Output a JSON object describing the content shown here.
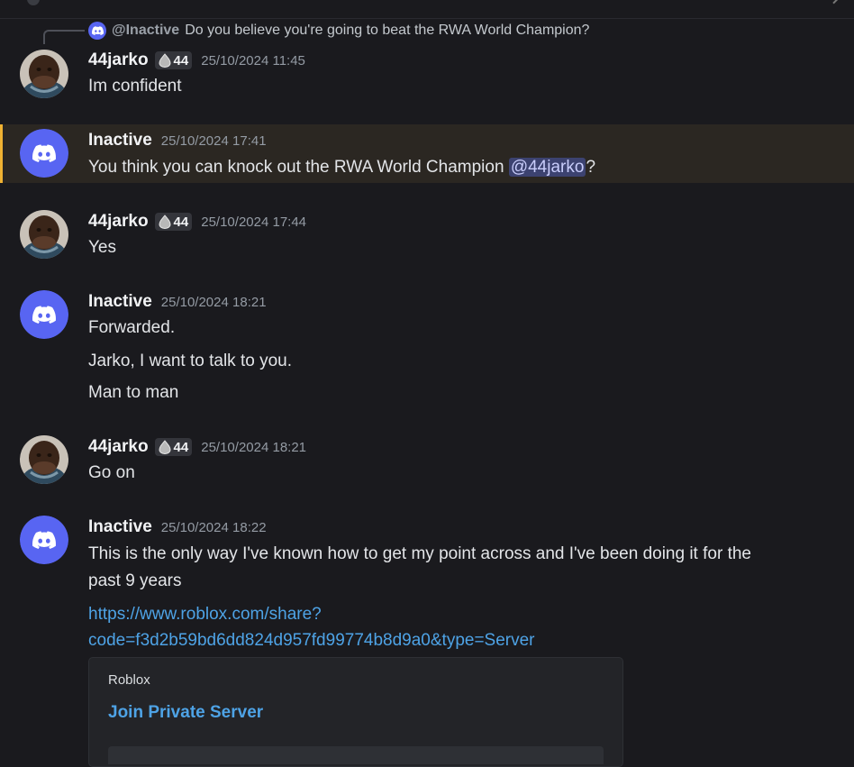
{
  "colors": {
    "background": "#1a1a1e",
    "highlight": "#2b2722",
    "highlight_bar": "#f0b232",
    "discord_blurple": "#5865f2",
    "link": "#4ea3e6",
    "mention_bg": "#3c4270"
  },
  "reply": {
    "author": "@Inactive",
    "text": "Do you believe you're going to beat the RWA World Champion?",
    "icon": "discord-logo-icon"
  },
  "messages": [
    {
      "author": "44jarko",
      "badge_icon": "tag-badge-icon",
      "badge": "44",
      "time": "25/10/2024 11:45",
      "lines": [
        "Im confident"
      ]
    },
    {
      "author": "Inactive",
      "time": "25/10/2024 17:41",
      "line_before": "You think you can knock out the RWA World Champion ",
      "mention": "@44jarko",
      "line_after": "?"
    },
    {
      "author": "44jarko",
      "badge_icon": "tag-badge-icon",
      "badge": "44",
      "time": "25/10/2024 17:44",
      "lines": [
        "Yes"
      ]
    },
    {
      "author": "Inactive",
      "time": "25/10/2024 18:21",
      "lines": [
        "Forwarded.",
        "Jarko, I want to talk to you.",
        "Man to man"
      ]
    },
    {
      "author": "44jarko",
      "badge_icon": "tag-badge-icon",
      "badge": "44",
      "time": "25/10/2024 18:21",
      "lines": [
        "Go on"
      ]
    },
    {
      "author": "Inactive",
      "time": "25/10/2024 18:22",
      "lines": [
        "This is the only way I've known how to get my point across and I've been doing it for the",
        "past 9 years"
      ],
      "link_lines": [
        "https://www.roblox.com/share?",
        "code=f3d2b59bd6dd824d957fd99774b8d9a0&type=Server"
      ]
    }
  ],
  "embed": {
    "provider": "Roblox",
    "title": "Join Private Server"
  }
}
